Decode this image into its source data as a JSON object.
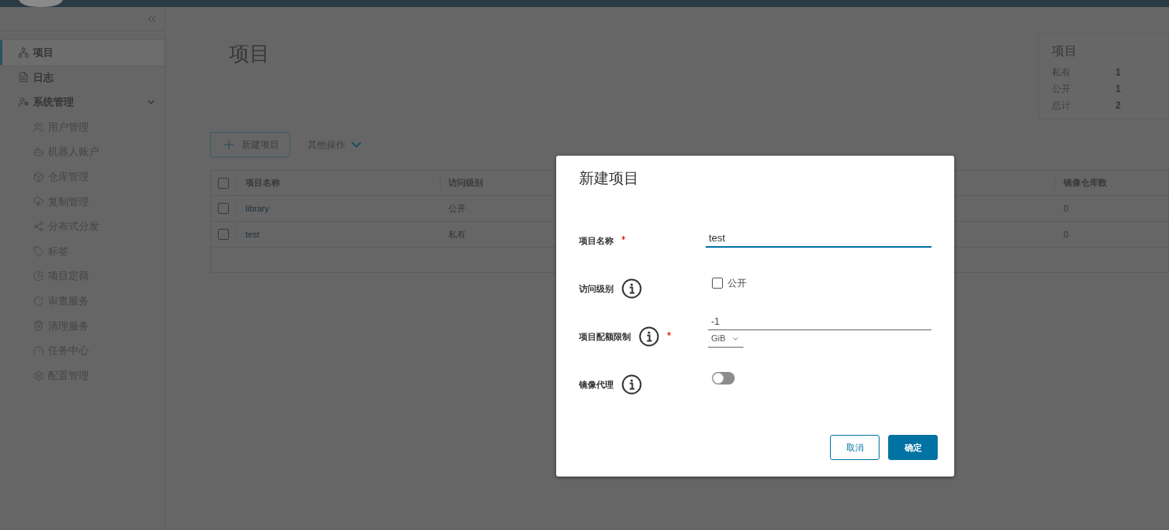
{
  "sidebar": {
    "items": [
      {
        "label": "项目",
        "selected": true
      },
      {
        "label": "日志",
        "selected": false
      },
      {
        "label": "系统管理",
        "selected": false,
        "expanded": true,
        "children": [
          {
            "label": "用户管理",
            "selected": false
          },
          {
            "label": "机器人账户",
            "selected": false
          },
          {
            "label": "仓库管理",
            "selected": false
          },
          {
            "label": "复制管理",
            "selected": false
          },
          {
            "label": "分布式分发",
            "selected": false
          },
          {
            "label": "标签",
            "selected": false
          },
          {
            "label": "项目定额",
            "selected": false
          },
          {
            "label": "审查服务",
            "selected": false
          },
          {
            "label": "清理服务",
            "selected": false
          },
          {
            "label": "任务中心",
            "selected": false
          },
          {
            "label": "配置管理",
            "selected": false
          }
        ]
      }
    ]
  },
  "page": {
    "title": "项目"
  },
  "summary": {
    "title": "项目",
    "rows": [
      {
        "label": "私有",
        "value": "1"
      },
      {
        "label": "公开",
        "value": "1"
      },
      {
        "label": "总计",
        "value": "2"
      }
    ]
  },
  "toolbar": {
    "new_button": "新建项目",
    "more_menu": "其他操作"
  },
  "table": {
    "columns": [
      "项目名称",
      "访问级别",
      "镜像仓库数"
    ],
    "select_all_checked": false,
    "rows": [
      {
        "name": "library",
        "access": "公开",
        "repo_count": "0",
        "checked": false
      },
      {
        "name": "test",
        "access": "私有",
        "repo_count": "0",
        "checked": false
      }
    ]
  },
  "dialog": {
    "title": "新建项目",
    "fields": [
      {
        "kind": "text",
        "label": "项目名称",
        "required": true,
        "info": false,
        "value": "test"
      },
      {
        "kind": "checkbox",
        "label": "访问级别",
        "required": false,
        "info": true,
        "option": "公开",
        "checked": false
      },
      {
        "kind": "quota",
        "label": "项目配额限制",
        "required": true,
        "info": true,
        "value": "-1",
        "unit": "GiB"
      },
      {
        "kind": "toggle",
        "label": "镜像代理",
        "required": false,
        "info": true,
        "on": false
      }
    ],
    "buttons": [
      {
        "label": "取消",
        "primary": false
      },
      {
        "label": "确定",
        "primary": true
      }
    ]
  }
}
